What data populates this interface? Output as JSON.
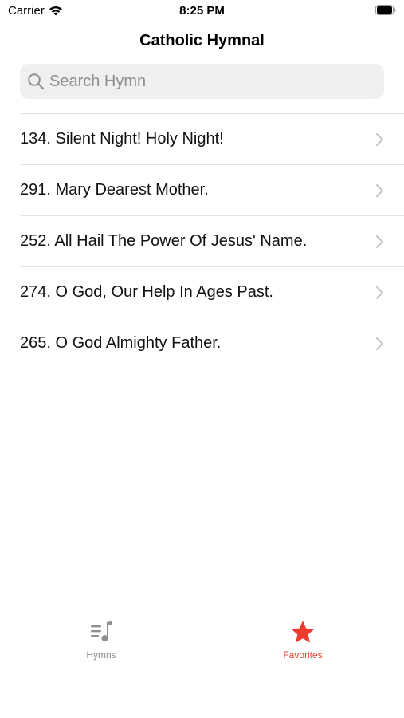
{
  "status_bar": {
    "carrier": "Carrier",
    "time": "8:25 PM"
  },
  "nav": {
    "title": "Catholic Hymnal"
  },
  "search": {
    "placeholder": "Search Hymn",
    "value": ""
  },
  "hymns": [
    {
      "label": "134. Silent Night! Holy Night!"
    },
    {
      "label": "291. Mary Dearest Mother."
    },
    {
      "label": "252. All Hail The Power Of Jesus' Name."
    },
    {
      "label": "274. O God, Our Help In Ages Past."
    },
    {
      "label": "265. O God Almighty Father."
    }
  ],
  "tabs": [
    {
      "label": "Hymns",
      "icon": "music-list-icon",
      "selected": false
    },
    {
      "label": "Favorites",
      "icon": "star-icon",
      "selected": true
    }
  ],
  "colors": {
    "accent": "#ef3b2f",
    "inactive": "#8e8e93",
    "search_bg": "#efeff0",
    "separator": "#e3e3e6"
  }
}
